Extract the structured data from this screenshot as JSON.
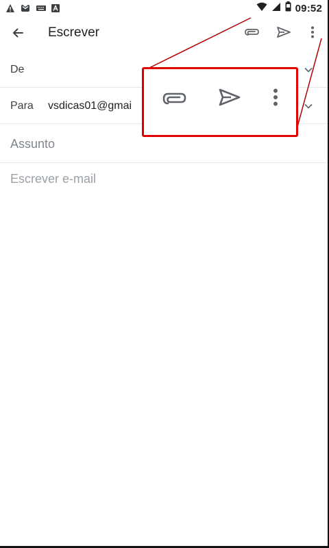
{
  "status_bar": {
    "time": "09:52",
    "left_icons": [
      "warning-icon",
      "gmail-icon",
      "keyboard-icon",
      "app-icon"
    ],
    "right_icons": [
      "wifi-icon",
      "signal-icon",
      "battery-icon"
    ]
  },
  "app_bar": {
    "title": "Escrever",
    "actions": [
      "attach-icon",
      "send-icon",
      "more-vert-icon"
    ]
  },
  "compose": {
    "from_label": "De",
    "to_label": "Para",
    "to_value": "vsdicas01@gmai",
    "subject_placeholder": "Assunto",
    "body_placeholder": "Escrever e-mail"
  },
  "callout": {
    "color": "#e00000",
    "icons": [
      "attach-icon",
      "send-icon",
      "more-vert-icon"
    ]
  },
  "colors": {
    "text_primary": "#202124",
    "placeholder": "#9aa0a6",
    "icon": "#5f6368",
    "divider": "#e6e6e6"
  }
}
